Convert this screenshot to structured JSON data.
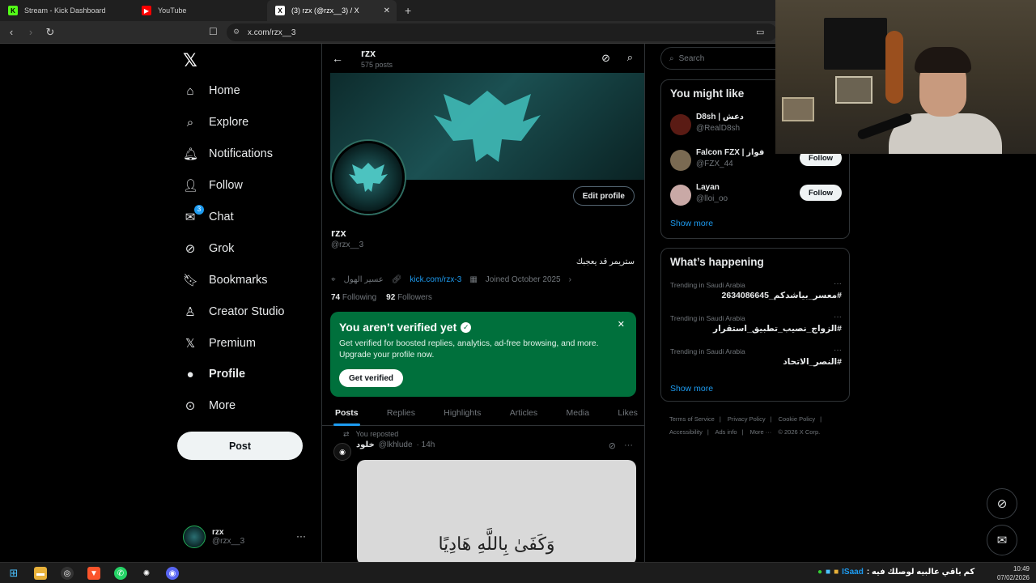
{
  "browser": {
    "tabs": [
      {
        "label": "Stream - Kick Dashboard",
        "icon": "kick-icon"
      },
      {
        "label": "YouTube",
        "icon": "youtube-icon"
      },
      {
        "label": "(3) rzx (@rzx__3) / X",
        "icon": "x-icon",
        "active": true
      }
    ],
    "url": "x.com/rzx__3",
    "new_tab": "+"
  },
  "sidebar": {
    "items": [
      {
        "label": "Home",
        "icon": "home-icon"
      },
      {
        "label": "Explore",
        "icon": "search-icon"
      },
      {
        "label": "Notifications",
        "icon": "bell-icon"
      },
      {
        "label": "Follow",
        "icon": "person-add-icon"
      },
      {
        "label": "Chat",
        "icon": "mail-icon",
        "badge": "3"
      },
      {
        "label": "Grok",
        "icon": "grok-icon"
      },
      {
        "label": "Bookmarks",
        "icon": "bookmark-icon"
      },
      {
        "label": "Creator Studio",
        "icon": "creator-icon"
      },
      {
        "label": "Premium",
        "icon": "x-icon"
      },
      {
        "label": "Profile",
        "icon": "person-icon",
        "active": true
      },
      {
        "label": "More",
        "icon": "more-circle-icon"
      }
    ],
    "post_label": "Post",
    "account": {
      "name": "rzx",
      "handle": "@rzx__3"
    }
  },
  "profile": {
    "header_name": "rzx",
    "post_count": "575 posts",
    "name": "rzx",
    "handle": "@rzx__3",
    "bio": "ستريمر قد يعجبك",
    "location": "عسير الهول",
    "link": "kick.com/rzx-3",
    "joined": "Joined October 2025",
    "following_count": "74",
    "following_label": "Following",
    "followers_count": "92",
    "followers_label": "Followers",
    "edit_label": "Edit profile"
  },
  "verify_card": {
    "title": "You aren’t verified yet",
    "text": "Get verified for boosted replies, analytics, ad-free browsing, and more. Upgrade your profile now.",
    "button": "Get verified",
    "accent": "#00703c"
  },
  "tabs": [
    "Posts",
    "Replies",
    "Highlights",
    "Articles",
    "Media",
    "Likes"
  ],
  "post": {
    "repost_label": "You reposted",
    "author_name": "خلود",
    "author_handle": "@lkhlude",
    "time": "· 14h",
    "image_text": "وَكَفَىٰ بِاللَّهِ هَادِيًا"
  },
  "right": {
    "search_placeholder": "Search",
    "you_might_like": {
      "title": "You might like",
      "people": [
        {
          "name": "D8sh | دعش",
          "handle": "@RealD8sh"
        },
        {
          "name": "Falcon FZX | فواز",
          "handle": "@FZX_44",
          "button": "Follow"
        },
        {
          "name": "Layan",
          "handle": "@lloi_oo",
          "button": "Follow"
        }
      ],
      "show_more": "Show more"
    },
    "whats_happening": {
      "title": "What’s happening",
      "trends": [
        {
          "category": "Trending in Saudi Arabia",
          "tag": "#معسر_بياشدكم_2634086645"
        },
        {
          "category": "Trending in Saudi Arabia",
          "tag": "#الزواج_نصيب_تطبيق_استقرار"
        },
        {
          "category": "Trending in Saudi Arabia",
          "tag": "#النصر_الاتحاد"
        }
      ],
      "show_more": "Show more"
    },
    "footer": [
      "Terms of Service",
      "|",
      "Privacy Policy",
      "|",
      "Cookie Policy",
      "|",
      "Accessibility",
      "|",
      "Ads info",
      "|",
      "More ···",
      "© 2026 X Corp."
    ]
  },
  "taskbar": {
    "ticker": "كم باقي عالبيه لوصلك فيه :",
    "tray_user": "ISaad",
    "time": "10:49",
    "date": "07/02/2026"
  }
}
